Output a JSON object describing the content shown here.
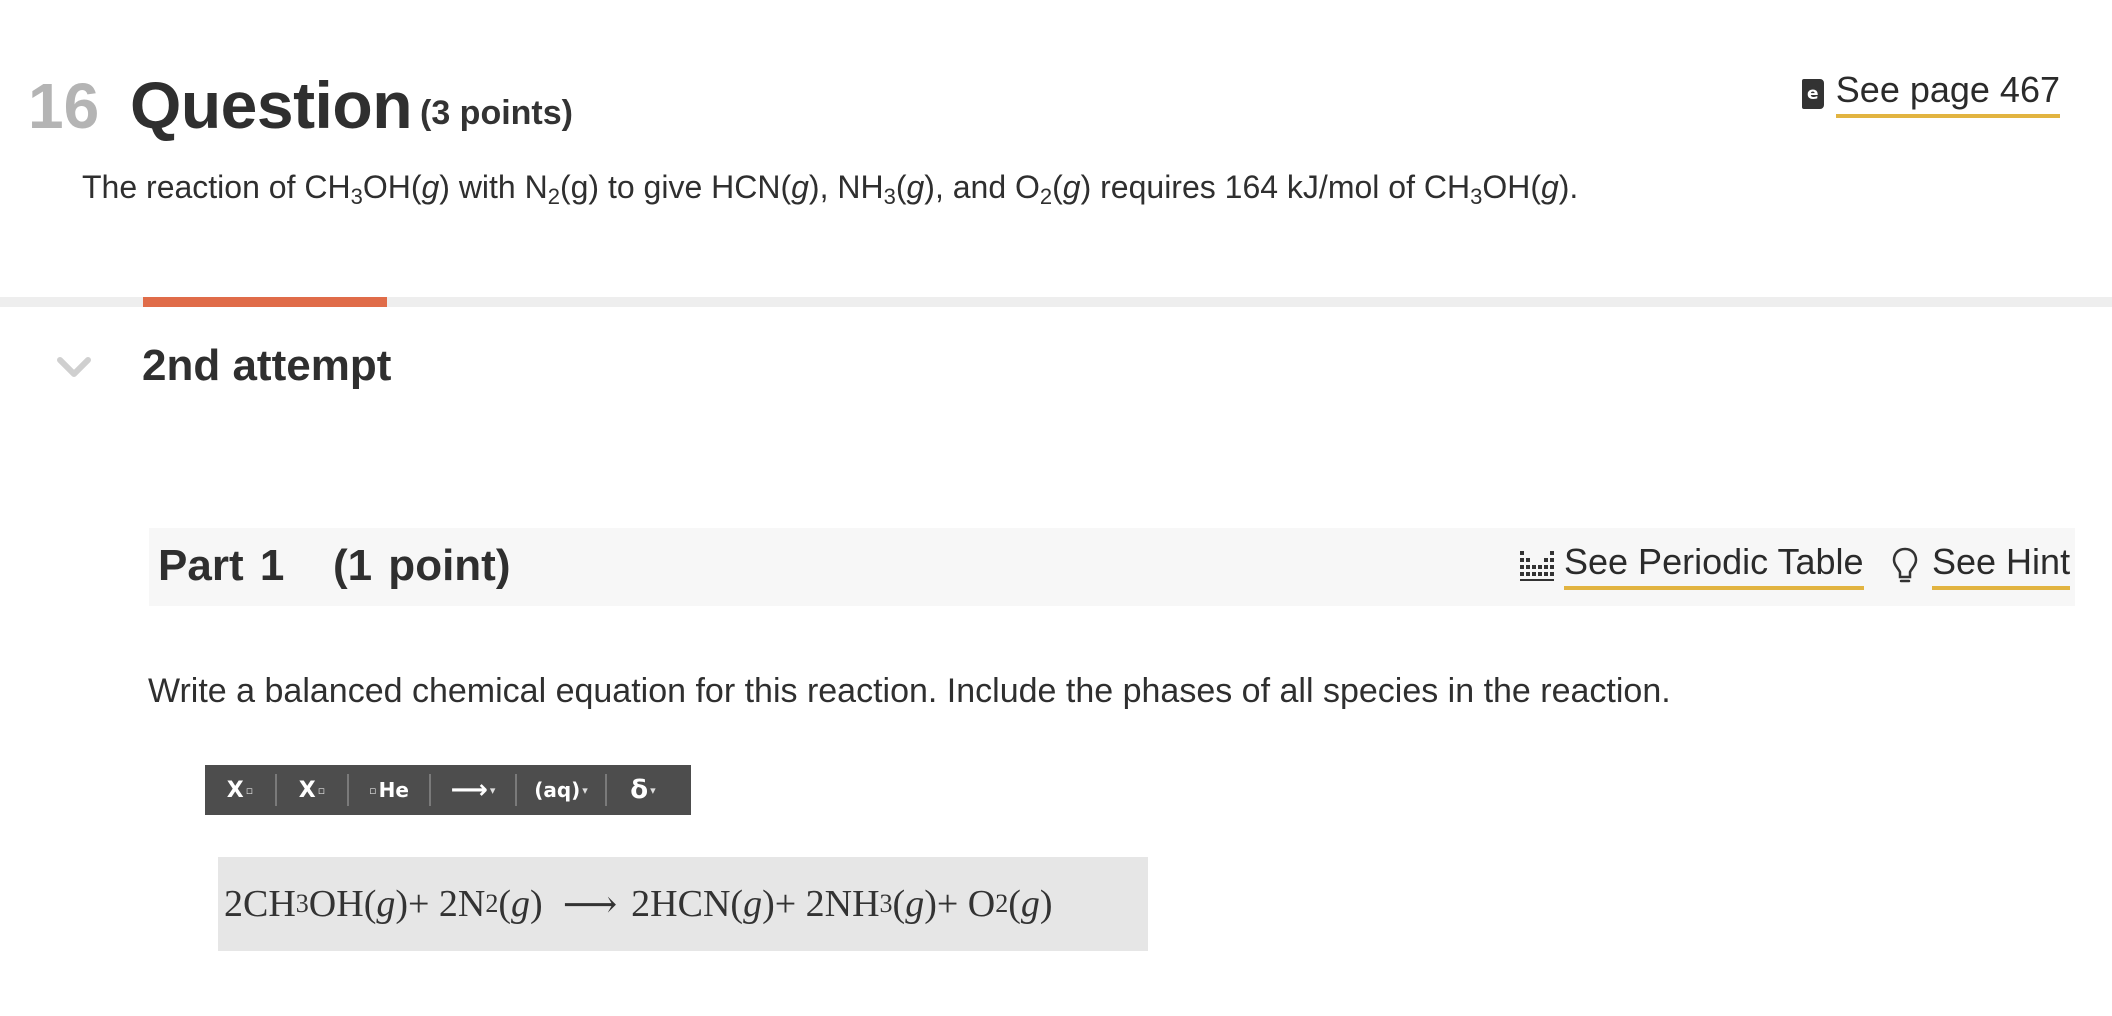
{
  "question": {
    "number": "16",
    "title": "Question",
    "points": "(3 points)",
    "see_page": "See page 467",
    "book_icon_glyph": "e",
    "prompt": {
      "t1": "The reaction of CH",
      "s1": "3",
      "t2": "OH(",
      "g1": "g",
      "t3": ") with N",
      "s2": "2",
      "t4": "(g) to give HCN(",
      "g2": "g",
      "t5": "), NH",
      "s3": "3",
      "t6": "(",
      "g3": "g",
      "t7": "), and O",
      "s4": "2",
      "t8": "(",
      "g4": "g",
      "t9": ") requires 164 kJ/mol of CH",
      "s5": "3",
      "t10": "OH(",
      "g5": "g",
      "t11": ")."
    }
  },
  "progress": {
    "fraction": 0.115,
    "color": "#e06c49"
  },
  "attempt": {
    "label": "2nd attempt"
  },
  "part": {
    "title": "Part 1   (1 point)",
    "periodic_label": "See Periodic Table",
    "hint_label": "See Hint"
  },
  "instruction": "Write a balanced chemical equation for this reaction. Include the phases of all species in the reaction.",
  "toolbar": {
    "superscript": "X",
    "subscript": "X",
    "element": "He",
    "arrow": "⟶",
    "aq": "(aq)",
    "delta": "δ"
  },
  "answer": {
    "a1": "2CH",
    "a1s": "3",
    "a2": "OH",
    "a2p1": "(",
    "a2g": "g",
    "a2p2": ")",
    "a3": " + 2N",
    "a3s": "2",
    "a3p1": "(",
    "a3g": "g",
    "a3p2": ")",
    "arrow": "⟶",
    "a4": "2HCN",
    "a4p1": "(",
    "a4g": "g",
    "a4p2": ")",
    "a5": " + 2NH",
    "a5s": "3",
    "a5p1": "(",
    "a5g": "g",
    "a5p2": ")",
    "a6": " + O",
    "a6s": "2",
    "a6p1": "(",
    "a6g": "g",
    "a6p2": ")"
  },
  "colors": {
    "link_underline": "#e2b441",
    "toolbar_bg": "#4d4d4d",
    "answer_bg": "#e6e6e6"
  }
}
